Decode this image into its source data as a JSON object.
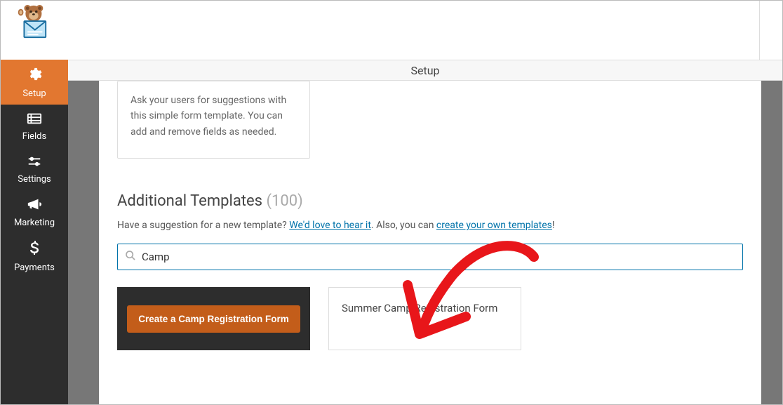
{
  "header": {
    "title": "Setup"
  },
  "sidebar": {
    "items": [
      {
        "label": "Setup"
      },
      {
        "label": "Fields"
      },
      {
        "label": "Settings"
      },
      {
        "label": "Marketing"
      },
      {
        "label": "Payments"
      }
    ]
  },
  "template_card": {
    "description": "Ask your users for suggestions with this simple form template. You can add and remove fields as needed."
  },
  "section": {
    "title": "Additional Templates",
    "count": "(100)"
  },
  "suggestion": {
    "text_before": "Have a suggestion for a new template? ",
    "link1": "We'd love to hear it",
    "text_mid": ". Also, you can ",
    "link2": "create your own templates",
    "text_after": "!"
  },
  "search": {
    "value": "Camp",
    "placeholder": ""
  },
  "results": {
    "primary_button": "Create a Camp Registration Form",
    "secondary_label": "Summer Camp Registration Form"
  }
}
